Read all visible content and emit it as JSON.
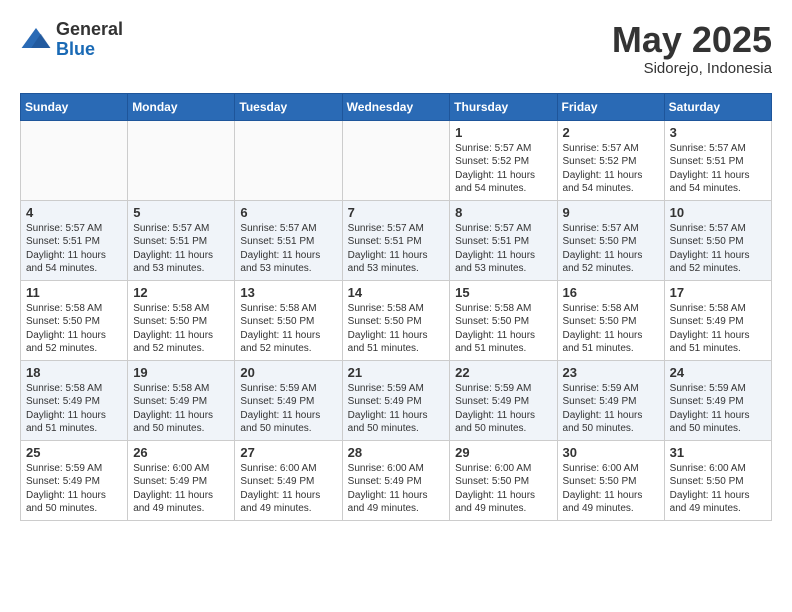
{
  "header": {
    "logo_general": "General",
    "logo_blue": "Blue",
    "month_title": "May 2025",
    "location": "Sidorejo, Indonesia"
  },
  "days_of_week": [
    "Sunday",
    "Monday",
    "Tuesday",
    "Wednesday",
    "Thursday",
    "Friday",
    "Saturday"
  ],
  "weeks": [
    [
      {
        "day": "",
        "info": ""
      },
      {
        "day": "",
        "info": ""
      },
      {
        "day": "",
        "info": ""
      },
      {
        "day": "",
        "info": ""
      },
      {
        "day": "1",
        "info": "Sunrise: 5:57 AM\nSunset: 5:52 PM\nDaylight: 11 hours\nand 54 minutes."
      },
      {
        "day": "2",
        "info": "Sunrise: 5:57 AM\nSunset: 5:52 PM\nDaylight: 11 hours\nand 54 minutes."
      },
      {
        "day": "3",
        "info": "Sunrise: 5:57 AM\nSunset: 5:51 PM\nDaylight: 11 hours\nand 54 minutes."
      }
    ],
    [
      {
        "day": "4",
        "info": "Sunrise: 5:57 AM\nSunset: 5:51 PM\nDaylight: 11 hours\nand 54 minutes."
      },
      {
        "day": "5",
        "info": "Sunrise: 5:57 AM\nSunset: 5:51 PM\nDaylight: 11 hours\nand 53 minutes."
      },
      {
        "day": "6",
        "info": "Sunrise: 5:57 AM\nSunset: 5:51 PM\nDaylight: 11 hours\nand 53 minutes."
      },
      {
        "day": "7",
        "info": "Sunrise: 5:57 AM\nSunset: 5:51 PM\nDaylight: 11 hours\nand 53 minutes."
      },
      {
        "day": "8",
        "info": "Sunrise: 5:57 AM\nSunset: 5:51 PM\nDaylight: 11 hours\nand 53 minutes."
      },
      {
        "day": "9",
        "info": "Sunrise: 5:57 AM\nSunset: 5:50 PM\nDaylight: 11 hours\nand 52 minutes."
      },
      {
        "day": "10",
        "info": "Sunrise: 5:57 AM\nSunset: 5:50 PM\nDaylight: 11 hours\nand 52 minutes."
      }
    ],
    [
      {
        "day": "11",
        "info": "Sunrise: 5:58 AM\nSunset: 5:50 PM\nDaylight: 11 hours\nand 52 minutes."
      },
      {
        "day": "12",
        "info": "Sunrise: 5:58 AM\nSunset: 5:50 PM\nDaylight: 11 hours\nand 52 minutes."
      },
      {
        "day": "13",
        "info": "Sunrise: 5:58 AM\nSunset: 5:50 PM\nDaylight: 11 hours\nand 52 minutes."
      },
      {
        "day": "14",
        "info": "Sunrise: 5:58 AM\nSunset: 5:50 PM\nDaylight: 11 hours\nand 51 minutes."
      },
      {
        "day": "15",
        "info": "Sunrise: 5:58 AM\nSunset: 5:50 PM\nDaylight: 11 hours\nand 51 minutes."
      },
      {
        "day": "16",
        "info": "Sunrise: 5:58 AM\nSunset: 5:50 PM\nDaylight: 11 hours\nand 51 minutes."
      },
      {
        "day": "17",
        "info": "Sunrise: 5:58 AM\nSunset: 5:49 PM\nDaylight: 11 hours\nand 51 minutes."
      }
    ],
    [
      {
        "day": "18",
        "info": "Sunrise: 5:58 AM\nSunset: 5:49 PM\nDaylight: 11 hours\nand 51 minutes."
      },
      {
        "day": "19",
        "info": "Sunrise: 5:58 AM\nSunset: 5:49 PM\nDaylight: 11 hours\nand 50 minutes."
      },
      {
        "day": "20",
        "info": "Sunrise: 5:59 AM\nSunset: 5:49 PM\nDaylight: 11 hours\nand 50 minutes."
      },
      {
        "day": "21",
        "info": "Sunrise: 5:59 AM\nSunset: 5:49 PM\nDaylight: 11 hours\nand 50 minutes."
      },
      {
        "day": "22",
        "info": "Sunrise: 5:59 AM\nSunset: 5:49 PM\nDaylight: 11 hours\nand 50 minutes."
      },
      {
        "day": "23",
        "info": "Sunrise: 5:59 AM\nSunset: 5:49 PM\nDaylight: 11 hours\nand 50 minutes."
      },
      {
        "day": "24",
        "info": "Sunrise: 5:59 AM\nSunset: 5:49 PM\nDaylight: 11 hours\nand 50 minutes."
      }
    ],
    [
      {
        "day": "25",
        "info": "Sunrise: 5:59 AM\nSunset: 5:49 PM\nDaylight: 11 hours\nand 50 minutes."
      },
      {
        "day": "26",
        "info": "Sunrise: 6:00 AM\nSunset: 5:49 PM\nDaylight: 11 hours\nand 49 minutes."
      },
      {
        "day": "27",
        "info": "Sunrise: 6:00 AM\nSunset: 5:49 PM\nDaylight: 11 hours\nand 49 minutes."
      },
      {
        "day": "28",
        "info": "Sunrise: 6:00 AM\nSunset: 5:49 PM\nDaylight: 11 hours\nand 49 minutes."
      },
      {
        "day": "29",
        "info": "Sunrise: 6:00 AM\nSunset: 5:50 PM\nDaylight: 11 hours\nand 49 minutes."
      },
      {
        "day": "30",
        "info": "Sunrise: 6:00 AM\nSunset: 5:50 PM\nDaylight: 11 hours\nand 49 minutes."
      },
      {
        "day": "31",
        "info": "Sunrise: 6:00 AM\nSunset: 5:50 PM\nDaylight: 11 hours\nand 49 minutes."
      }
    ]
  ]
}
